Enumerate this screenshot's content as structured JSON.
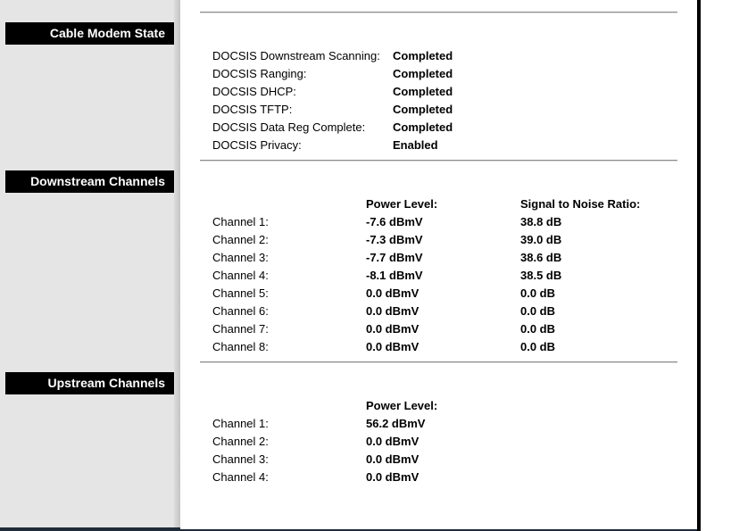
{
  "sections": {
    "cable_modem_state": {
      "label": "Cable Modem State"
    },
    "downstream": {
      "label": "Downstream Channels"
    },
    "upstream": {
      "label": "Upstream Channels"
    }
  },
  "modem_state": [
    {
      "label": "DOCSIS Downstream Scanning:",
      "value": "Completed"
    },
    {
      "label": "DOCSIS Ranging:",
      "value": "Completed"
    },
    {
      "label": "DOCSIS DHCP:",
      "value": "Completed"
    },
    {
      "label": "DOCSIS TFTP:",
      "value": "Completed"
    },
    {
      "label": "DOCSIS Data Reg Complete:",
      "value": "Completed"
    },
    {
      "label": "DOCSIS Privacy:",
      "value": "Enabled"
    }
  ],
  "downstream": {
    "power_header": "Power Level:",
    "snr_header": "Signal to Noise Ratio:",
    "channels": [
      {
        "label": "Channel 1:",
        "power": "-7.6 dBmV",
        "snr": "38.8 dB"
      },
      {
        "label": "Channel 2:",
        "power": "-7.3 dBmV",
        "snr": "39.0 dB"
      },
      {
        "label": "Channel 3:",
        "power": "-7.7 dBmV",
        "snr": "38.6 dB"
      },
      {
        "label": "Channel 4:",
        "power": "-8.1 dBmV",
        "snr": "38.5 dB"
      },
      {
        "label": "Channel 5:",
        "power": "0.0 dBmV",
        "snr": "0.0 dB"
      },
      {
        "label": "Channel 6:",
        "power": "0.0 dBmV",
        "snr": "0.0 dB"
      },
      {
        "label": "Channel 7:",
        "power": "0.0 dBmV",
        "snr": "0.0 dB"
      },
      {
        "label": "Channel 8:",
        "power": "0.0 dBmV",
        "snr": "0.0 dB"
      }
    ]
  },
  "upstream": {
    "power_header": "Power Level:",
    "channels": [
      {
        "label": "Channel 1:",
        "power": "56.2 dBmV"
      },
      {
        "label": "Channel 2:",
        "power": "0.0 dBmV"
      },
      {
        "label": "Channel 3:",
        "power": "0.0 dBmV"
      },
      {
        "label": "Channel 4:",
        "power": "0.0 dBmV"
      }
    ]
  }
}
